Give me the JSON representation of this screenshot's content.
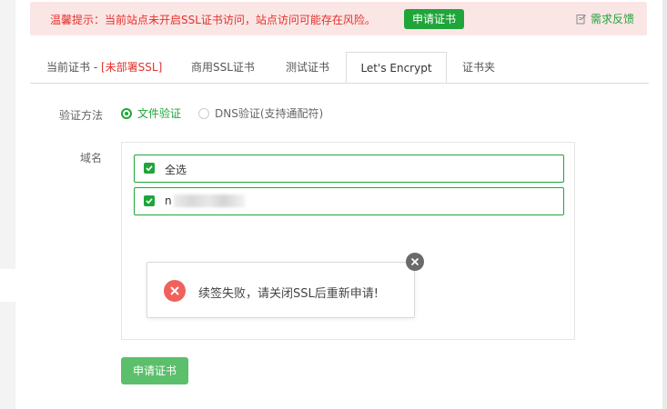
{
  "warning": {
    "text": "温馨提示：当前站点未开启SSL证书访问，站点访问可能存在风险。",
    "apply_button": "申请证书",
    "feedback": "需求反馈"
  },
  "tabs": [
    {
      "label": "当前证书 - ",
      "status": "[未部署SSL]"
    },
    {
      "label": "商用SSL证书"
    },
    {
      "label": "测试证书"
    },
    {
      "label": "Let's Encrypt"
    },
    {
      "label": "证书夹"
    }
  ],
  "form": {
    "verify_label": "验证方法",
    "verify_options": [
      {
        "label": "文件验证",
        "checked": true
      },
      {
        "label": "DNS验证(支持通配符)",
        "checked": false
      }
    ],
    "domain_label": "域名",
    "select_all": "全选",
    "domain_prefix": "n"
  },
  "popup": {
    "message": "续签失败，请关闭SSL后重新申请!"
  },
  "apply_button": "申请证书",
  "colors": {
    "accent": "#20a53a",
    "warning_red": "#e2312a",
    "error_icon": "#f0615d"
  }
}
